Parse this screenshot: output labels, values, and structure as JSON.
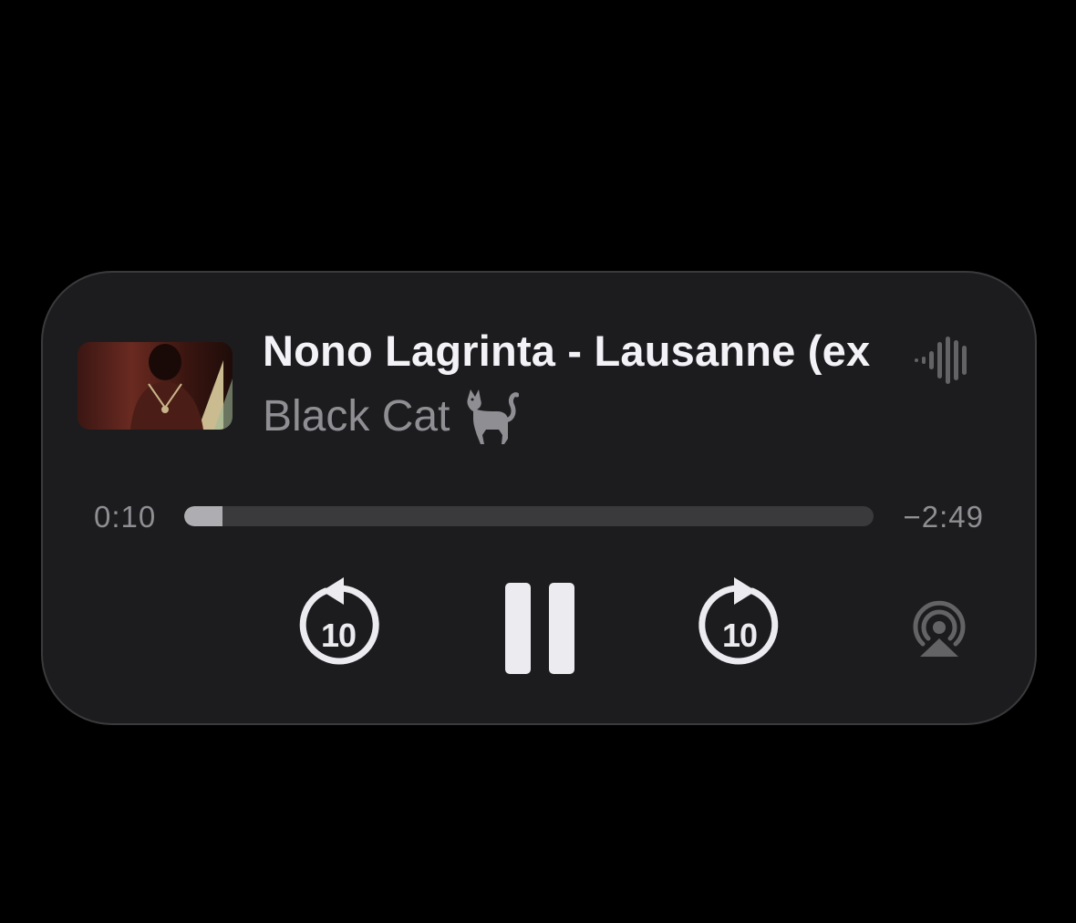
{
  "now_playing": {
    "title": "Nono Lagrinta - Lausanne (ex",
    "artist": "Black Cat",
    "artist_icon": "black-cat-emoji",
    "activity_icon": "waveform-icon"
  },
  "progress": {
    "elapsed": "0:10",
    "remaining": "−2:49",
    "fraction": 0.055
  },
  "controls": {
    "skip_back_seconds": "10",
    "skip_forward_seconds": "10",
    "play_state": "pause",
    "airplay_icon": "airplay-audio-icon"
  },
  "colors": {
    "background": "#000000",
    "card": "#1c1c1e",
    "primary_text": "#f2f2f7",
    "secondary_text": "#8e8e93",
    "track": "#3a3a3c",
    "track_fill": "#aeaeb2"
  }
}
